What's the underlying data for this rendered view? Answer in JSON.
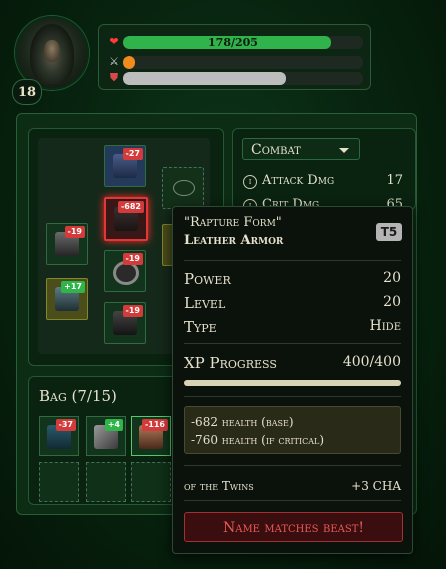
{
  "player": {
    "level": "18",
    "health_text": "178/205",
    "health_pct": 0.868,
    "xp_pct": 0.05,
    "armor_pct": 0.68,
    "icons": {
      "health": "heart-icon",
      "xp": "crossed-swords-icon",
      "armor": "shield-icon"
    }
  },
  "equipment": {
    "slots": [
      {
        "name": "helmet",
        "badge": "-27",
        "badge_type": "neg"
      },
      {
        "name": "chest",
        "badge": "-682",
        "badge_type": "neg",
        "selected": true
      },
      {
        "name": "hands",
        "badge": "-19",
        "badge_type": "neg"
      },
      {
        "name": "waist",
        "badge": "-19",
        "badge_type": "neg"
      },
      {
        "name": "weapon",
        "badge": "+17",
        "badge_type": "pos"
      },
      {
        "name": "feet",
        "badge": "-19",
        "badge_type": "neg"
      },
      {
        "name": "neck",
        "badge": ""
      },
      {
        "name": "ring",
        "badge": ""
      }
    ]
  },
  "combat": {
    "dropdown_label": "Combat",
    "stats": [
      {
        "icon": "info-icon",
        "label": "Attack Dmg",
        "value": "17"
      },
      {
        "icon": "info-icon",
        "label": "Crit Dmg",
        "value": "65"
      }
    ]
  },
  "bag": {
    "title": "Bag (7/15)",
    "items": [
      {
        "badge": "-37",
        "badge_type": "neg"
      },
      {
        "badge": "+4",
        "badge_type": "pos"
      },
      {
        "badge": "-116",
        "badge_type": "neg"
      }
    ]
  },
  "tooltip": {
    "name": "\"Rapture Form\"",
    "type": "Leather Armor",
    "tier": "T5",
    "power_label": "Power",
    "power": "20",
    "level_label": "Level",
    "level": "20",
    "type_label": "Type",
    "type_value": "Hide",
    "xp_label": "XP Progress",
    "xp_value": "400/400",
    "xp_pct": 1.0,
    "effect1": "-682 health (base)",
    "effect2": "-760 health (if critical)",
    "suffix_label": "of the Twins",
    "suffix_value": "+3 CHA",
    "beast_label": "Name matches beast!"
  },
  "colors": {
    "health": "#2fb34a",
    "xp": "#f08b1e",
    "armor": "#bdbdbd",
    "badge_neg": "#d33b3b",
    "badge_pos": "#2fb54a",
    "beast": "#e85a5a"
  }
}
